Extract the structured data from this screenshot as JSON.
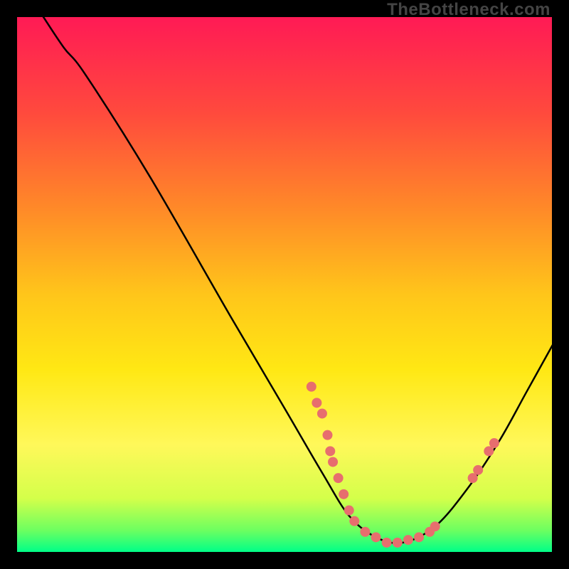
{
  "watermark": "TheBottleneck.com",
  "chart_data": {
    "type": "line",
    "title": "",
    "xlabel": "",
    "ylabel": "",
    "xlim": [
      0,
      100
    ],
    "ylim": [
      0,
      100
    ],
    "series": [
      {
        "name": "bottleneck-curve",
        "points": [
          {
            "x": 5,
            "y": 100
          },
          {
            "x": 9,
            "y": 94
          },
          {
            "x": 13,
            "y": 89
          },
          {
            "x": 25,
            "y": 70
          },
          {
            "x": 40,
            "y": 44
          },
          {
            "x": 50,
            "y": 27
          },
          {
            "x": 57,
            "y": 15
          },
          {
            "x": 62,
            "y": 7
          },
          {
            "x": 67,
            "y": 3
          },
          {
            "x": 72,
            "y": 2
          },
          {
            "x": 78,
            "y": 5
          },
          {
            "x": 84,
            "y": 12
          },
          {
            "x": 90,
            "y": 21
          },
          {
            "x": 95,
            "y": 30
          },
          {
            "x": 100,
            "y": 39
          }
        ]
      }
    ],
    "markers": [
      {
        "x": 55,
        "y": 31
      },
      {
        "x": 56,
        "y": 28
      },
      {
        "x": 57,
        "y": 26
      },
      {
        "x": 58,
        "y": 22
      },
      {
        "x": 58.5,
        "y": 19
      },
      {
        "x": 59,
        "y": 17
      },
      {
        "x": 60,
        "y": 14
      },
      {
        "x": 61,
        "y": 11
      },
      {
        "x": 62,
        "y": 8
      },
      {
        "x": 63,
        "y": 6
      },
      {
        "x": 65,
        "y": 4
      },
      {
        "x": 67,
        "y": 3
      },
      {
        "x": 69,
        "y": 2
      },
      {
        "x": 71,
        "y": 2
      },
      {
        "x": 73,
        "y": 2.5
      },
      {
        "x": 75,
        "y": 3
      },
      {
        "x": 77,
        "y": 4
      },
      {
        "x": 78,
        "y": 5
      },
      {
        "x": 85,
        "y": 14
      },
      {
        "x": 86,
        "y": 15.5
      },
      {
        "x": 88,
        "y": 19
      },
      {
        "x": 89,
        "y": 20.5
      }
    ]
  }
}
